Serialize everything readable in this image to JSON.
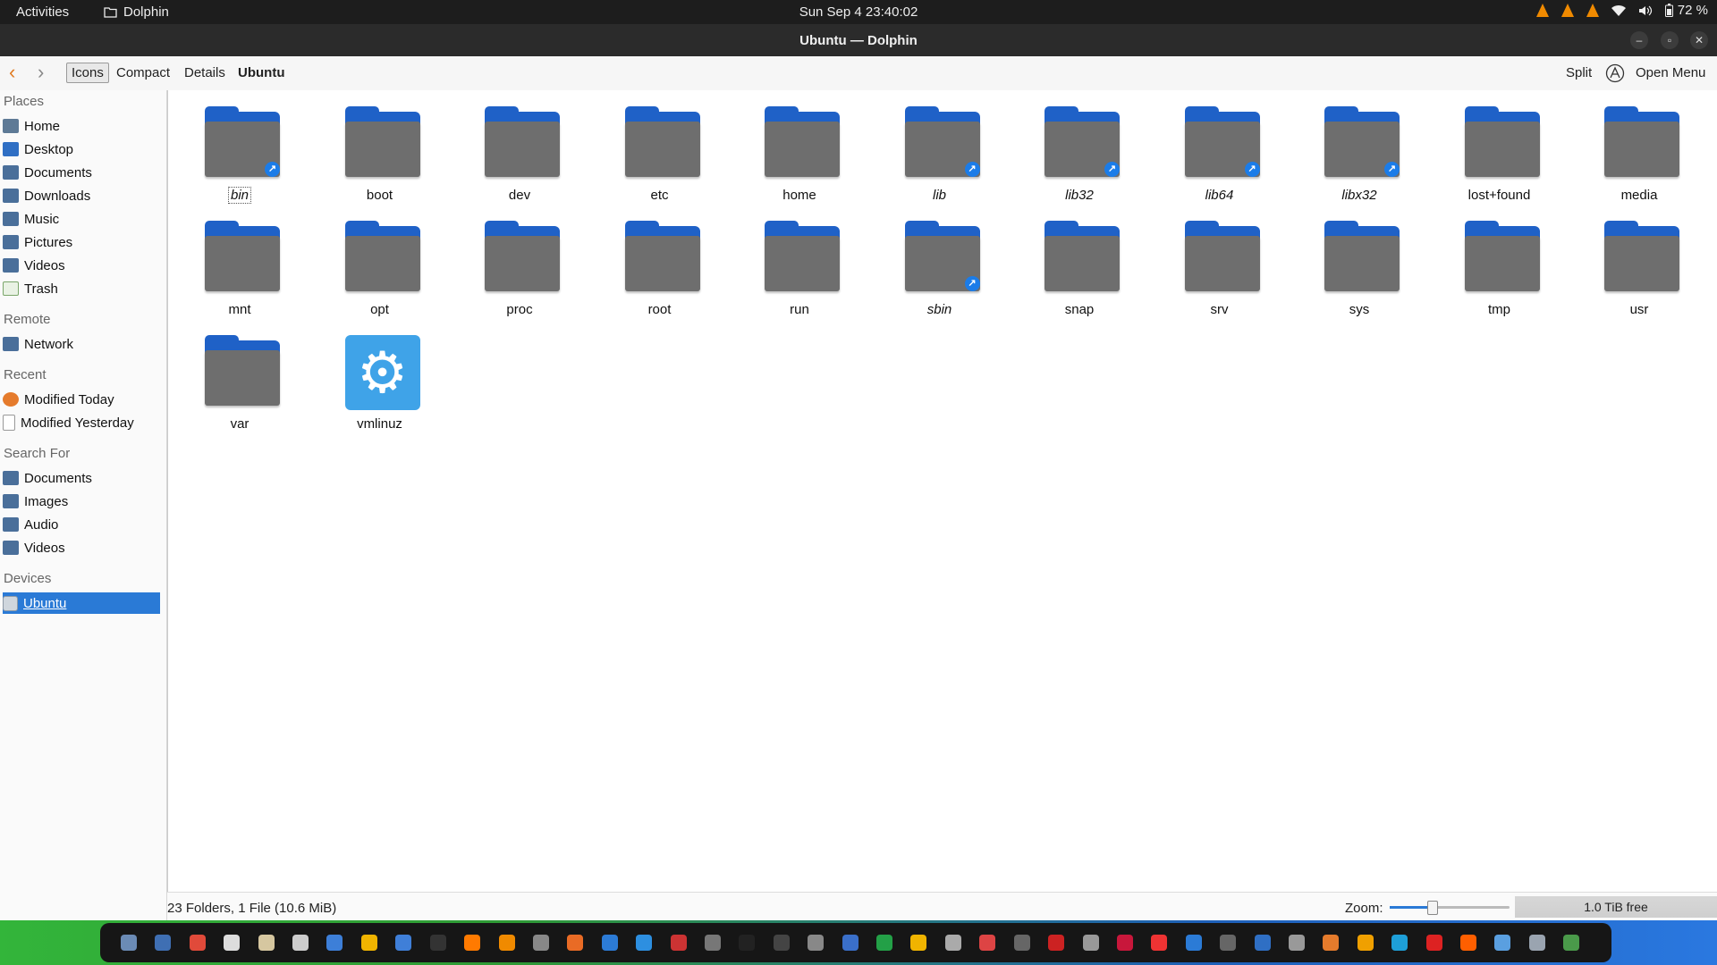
{
  "topbar": {
    "activities": "Activities",
    "app_name": "Dolphin",
    "clock": "Sun Sep 4  23:40:02",
    "battery": "72 %"
  },
  "window": {
    "title": "Ubuntu — Dolphin"
  },
  "toolbar": {
    "view_icons": "Icons",
    "view_compact": "Compact",
    "view_details": "Details",
    "location": "Ubuntu",
    "split": "Split",
    "open_menu": "Open Menu"
  },
  "sidebar": {
    "places_label": "Places",
    "places": [
      "Home",
      "Desktop",
      "Documents",
      "Downloads",
      "Music",
      "Pictures",
      "Videos",
      "Trash"
    ],
    "remote_label": "Remote",
    "remote": [
      "Network"
    ],
    "recent_label": "Recent",
    "recent": [
      "Modified Today",
      "Modified Yesterday"
    ],
    "search_label": "Search For",
    "search": [
      "Documents",
      "Images",
      "Audio",
      "Videos"
    ],
    "devices_label": "Devices",
    "devices": [
      "Ubuntu"
    ]
  },
  "files": [
    {
      "name": "bin",
      "link": true
    },
    {
      "name": "boot",
      "link": false
    },
    {
      "name": "dev",
      "link": false
    },
    {
      "name": "etc",
      "link": false
    },
    {
      "name": "home",
      "link": false
    },
    {
      "name": "lib",
      "link": true
    },
    {
      "name": "lib32",
      "link": true
    },
    {
      "name": "lib64",
      "link": true
    },
    {
      "name": "libx32",
      "link": true
    },
    {
      "name": "lost+found",
      "link": false
    },
    {
      "name": "media",
      "link": false
    },
    {
      "name": "mnt",
      "link": false
    },
    {
      "name": "opt",
      "link": false
    },
    {
      "name": "proc",
      "link": false
    },
    {
      "name": "root",
      "link": false
    },
    {
      "name": "run",
      "link": false
    },
    {
      "name": "sbin",
      "link": true
    },
    {
      "name": "snap",
      "link": false
    },
    {
      "name": "srv",
      "link": false
    },
    {
      "name": "sys",
      "link": false
    },
    {
      "name": "tmp",
      "link": false
    },
    {
      "name": "usr",
      "link": false
    },
    {
      "name": "var",
      "link": false
    },
    {
      "name": "vmlinuz",
      "link": false,
      "type": "file"
    }
  ],
  "status": {
    "info": "23 Folders, 1 File (10.6 MiB)",
    "zoom_label": "Zoom:",
    "zoom_level": 0.35,
    "free_space": "1.0 TiB free"
  },
  "colors": {
    "accent": "#2a7ad6",
    "folder_tab": "#1f61c7",
    "folder_body": "#6e6e6e",
    "link_badge": "#1b7ce8"
  }
}
